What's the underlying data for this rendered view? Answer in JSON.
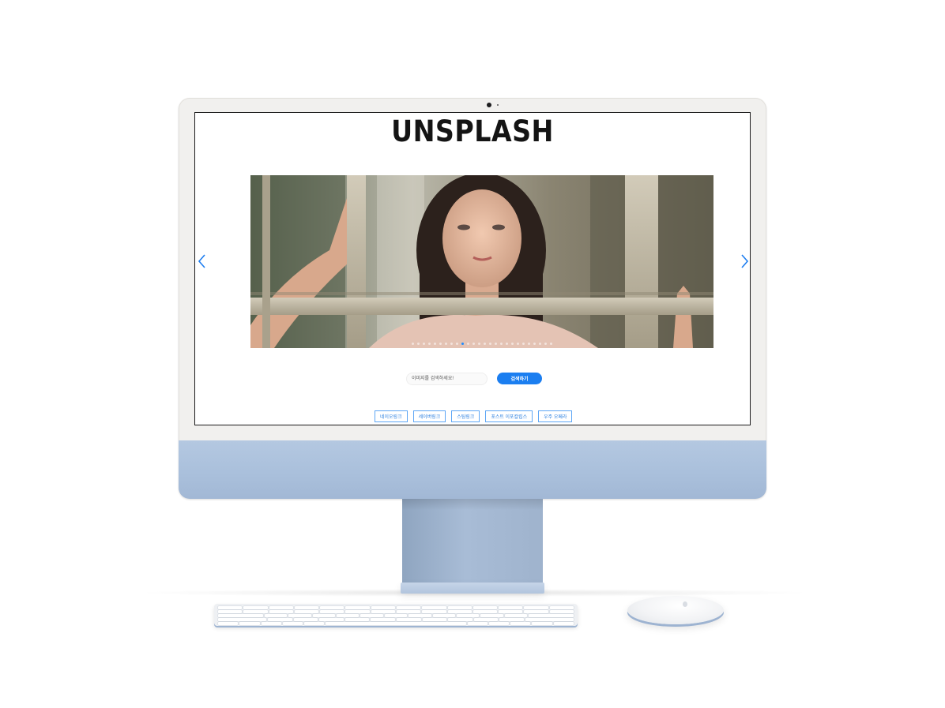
{
  "brand": {
    "logo_text": "UNSPLASH"
  },
  "carousel": {
    "slide_count": 26,
    "active_slide": 9,
    "prev_icon": "chevron-left-icon",
    "next_icon": "chevron-right-icon"
  },
  "search": {
    "placeholder": "이미지를 검색하세요!",
    "button_label": "검색하기"
  },
  "links": [
    {
      "label": "네이오링크"
    },
    {
      "label": "세이버링크"
    },
    {
      "label": "스팀링크"
    },
    {
      "label": "포스트 이포칼립스"
    },
    {
      "label": "우주 오페라"
    }
  ],
  "colors": {
    "accent": "#1b7ef0",
    "link_border": "#5da6f5",
    "chassis_blue": "#aec3de",
    "bezel": "#f1f0ee"
  }
}
